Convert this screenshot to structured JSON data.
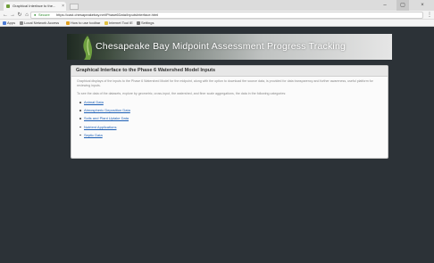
{
  "browser": {
    "tab_title": "Graphical Interface to the...",
    "url_secure_label": "Secure",
    "url": "https://cast.chesapeakebay.net/Phase6Data/InputsInterface.html",
    "bookmarks": [
      {
        "label": "Apps",
        "color": "#4b7bd6"
      },
      {
        "label": "Local Network Access",
        "color": "#888888"
      },
      {
        "label": "How to use toolbar",
        "color": "#e0a020"
      },
      {
        "label": "Internet Tool IE",
        "color": "#e0c040"
      },
      {
        "label": "Settings",
        "color": "#777777"
      }
    ]
  },
  "banner": {
    "title": "Chesapeake Bay Midpoint Assessment Progress Tracking"
  },
  "panel": {
    "heading": "Graphical Interface to the Phase 6 Watershed Model Inputs",
    "intro": "Graphical displays of the inputs to the Phase 6 Watershed Model for the midpoint, along with the option to download the source data, is provided for data transparency and further awareness, useful platform for reviewing inputs.",
    "lead": "To see the data of the datasets, explore by geometric, cross-input, the watershed, and finer scale aggregations, the data in the following categories:",
    "links": [
      "Animal Data",
      "Atmospheric Deposition Data",
      "Soils and Plant Uptake Data",
      "Nutrient Applications",
      "Septic Data"
    ]
  },
  "colors": {
    "page_background": "#2c3237",
    "link": "#1d5fb5"
  }
}
